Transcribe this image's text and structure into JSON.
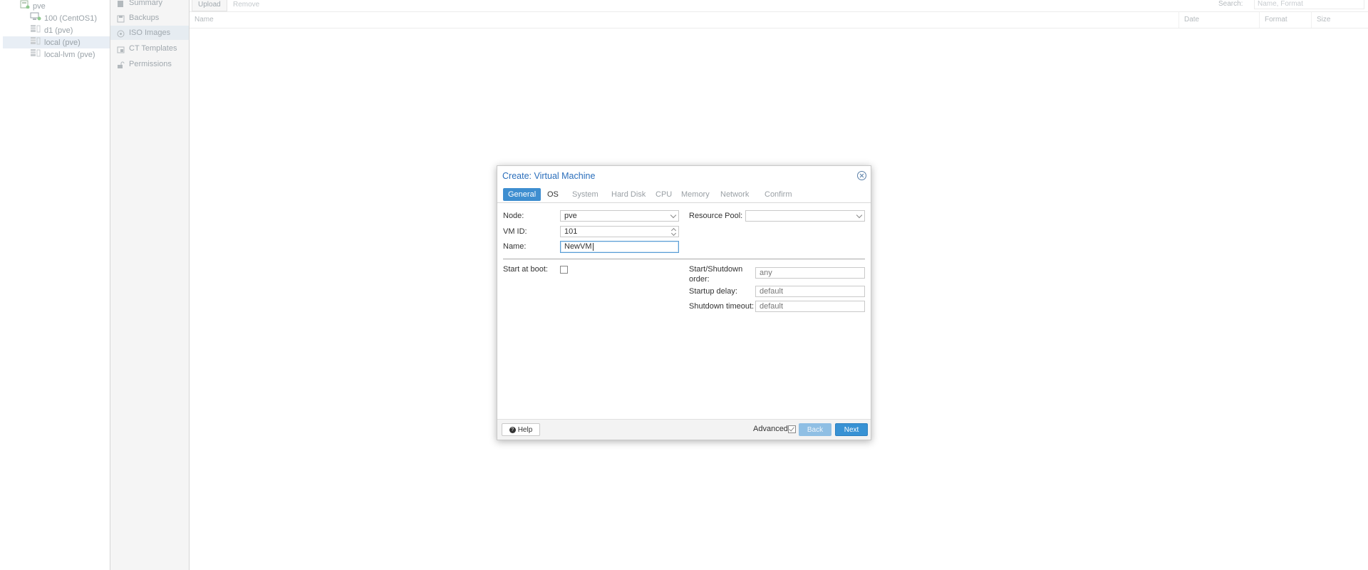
{
  "tree": {
    "items": [
      {
        "label": "pve",
        "icon": "server-icon"
      },
      {
        "label": "100 (CentOS1)",
        "icon": "vm-icon"
      },
      {
        "label": "d1 (pve)",
        "icon": "storage-icon"
      },
      {
        "label": "local (pve)",
        "icon": "storage-icon",
        "selected": true
      },
      {
        "label": "local-lvm (pve)",
        "icon": "storage-icon"
      }
    ]
  },
  "menu": {
    "items": [
      {
        "label": "Summary",
        "icon": "book-icon"
      },
      {
        "label": "Backups",
        "icon": "floppy-icon"
      },
      {
        "label": "ISO Images",
        "icon": "disc-icon",
        "selected": true
      },
      {
        "label": "CT Templates",
        "icon": "template-icon"
      },
      {
        "label": "Permissions",
        "icon": "unlock-icon"
      }
    ]
  },
  "toolbar": {
    "upload": "Upload",
    "remove": "Remove",
    "search_label": "Search:",
    "search_placeholder": "Name, Format"
  },
  "grid": {
    "columns": [
      "Name",
      "Date",
      "Format",
      "Size"
    ]
  },
  "dialog": {
    "title": "Create: Virtual Machine",
    "tabs": [
      "General",
      "OS",
      "System",
      "Hard Disk",
      "CPU",
      "Memory",
      "Network",
      "Confirm"
    ],
    "active_tab": "General",
    "node_label": "Node:",
    "node_value": "pve",
    "resource_pool_label": "Resource Pool:",
    "resource_pool_value": "",
    "vmid_label": "VM ID:",
    "vmid_value": "101",
    "name_label": "Name:",
    "name_value": "NewVM",
    "start_at_boot_label": "Start at boot:",
    "start_at_boot_checked": false,
    "start_shutdown_label_line1": "Start/Shutdown",
    "start_shutdown_label_line2": "order:",
    "start_shutdown_placeholder": "any",
    "startup_delay_label": "Startup delay:",
    "startup_delay_placeholder": "default",
    "shutdown_timeout_label": "Shutdown timeout:",
    "shutdown_timeout_placeholder": "default",
    "help_button": "Help",
    "advanced_label": "Advanced",
    "advanced_checked": true,
    "back_button": "Back",
    "next_button": "Next"
  },
  "colors": {
    "accent": "#3892d4",
    "title": "#2a6ebb"
  }
}
